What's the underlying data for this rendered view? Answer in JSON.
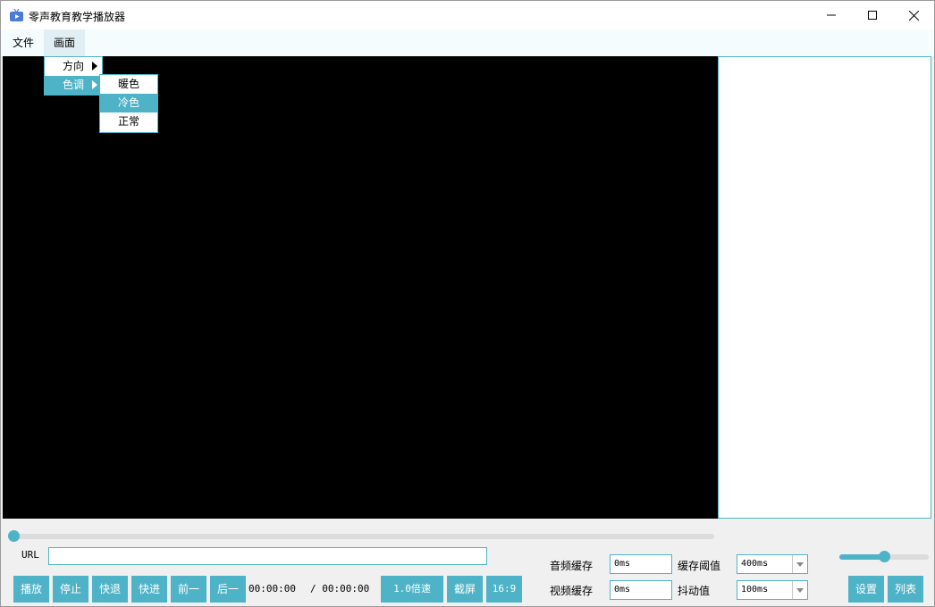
{
  "window": {
    "title": "零声教育教学播放器",
    "controls": {
      "minimize": "minimize-icon",
      "maximize": "maximize-icon",
      "close": "close-icon"
    }
  },
  "menubar": {
    "items": [
      {
        "label": "文件"
      },
      {
        "label": "画面"
      }
    ]
  },
  "menu_huamian": {
    "items": [
      {
        "label": "方向"
      },
      {
        "label": "色调"
      }
    ]
  },
  "submenu_sediao": {
    "items": [
      {
        "label": "暖色"
      },
      {
        "label": "冷色"
      },
      {
        "label": "正常"
      }
    ]
  },
  "playback": {
    "progress": 0,
    "url_label": "URL",
    "url_value": "",
    "buttons": {
      "play": "播放",
      "stop": "停止",
      "rewind": "快退",
      "forward": "快进",
      "prev": "前一",
      "next": "后一"
    },
    "current_time": "00:00:00",
    "total_time": "/ 00:00:00",
    "speed": "1.0倍速",
    "screenshot": "截屏",
    "aspect": "16:9"
  },
  "buffer": {
    "audio_label": "音频缓存",
    "audio_value": "0ms",
    "video_label": "视频缓存",
    "video_value": "0ms",
    "threshold_label": "缓存阈值",
    "threshold_value": "400ms",
    "jitter_label": "抖动值",
    "jitter_value": "100ms"
  },
  "volume": {
    "level": 0.5
  },
  "actions": {
    "settings": "设置",
    "list": "列表"
  },
  "colors": {
    "accent": "#4fb3c8"
  }
}
